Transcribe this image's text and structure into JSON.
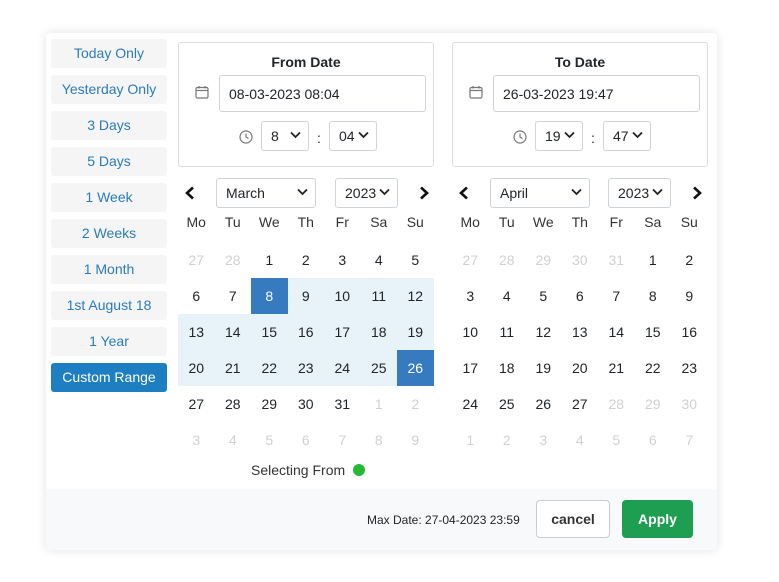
{
  "ranges": [
    {
      "label": "Today Only",
      "active": false
    },
    {
      "label": "Yesterday Only",
      "active": false
    },
    {
      "label": "3 Days",
      "active": false
    },
    {
      "label": "5 Days",
      "active": false
    },
    {
      "label": "1 Week",
      "active": false
    },
    {
      "label": "2 Weeks",
      "active": false
    },
    {
      "label": "1 Month",
      "active": false
    },
    {
      "label": "1st August 18",
      "active": false
    },
    {
      "label": "1 Year",
      "active": false
    },
    {
      "label": "Custom Range",
      "active": true
    }
  ],
  "from": {
    "title": "From Date",
    "value": "08-03-2023 08:04",
    "hour": "8",
    "minute": "04"
  },
  "to": {
    "title": "To Date",
    "value": "26-03-2023 19:47",
    "hour": "19",
    "minute": "47"
  },
  "time_separator": ":",
  "weekdays": [
    "Mo",
    "Tu",
    "We",
    "Th",
    "Fr",
    "Sa",
    "Su"
  ],
  "left_calendar": {
    "month": "March",
    "year": "2023",
    "days": [
      {
        "d": "27",
        "m": true
      },
      {
        "d": "28",
        "m": true
      },
      {
        "d": "1"
      },
      {
        "d": "2"
      },
      {
        "d": "3"
      },
      {
        "d": "4"
      },
      {
        "d": "5"
      },
      {
        "d": "6"
      },
      {
        "d": "7"
      },
      {
        "d": "8",
        "e": true
      },
      {
        "d": "9",
        "r": true
      },
      {
        "d": "10",
        "r": true
      },
      {
        "d": "11",
        "r": true
      },
      {
        "d": "12",
        "r": true
      },
      {
        "d": "13",
        "r": true
      },
      {
        "d": "14",
        "r": true
      },
      {
        "d": "15",
        "r": true
      },
      {
        "d": "16",
        "r": true
      },
      {
        "d": "17",
        "r": true
      },
      {
        "d": "18",
        "r": true
      },
      {
        "d": "19",
        "r": true
      },
      {
        "d": "20",
        "r": true
      },
      {
        "d": "21",
        "r": true
      },
      {
        "d": "22",
        "r": true
      },
      {
        "d": "23",
        "r": true
      },
      {
        "d": "24",
        "r": true
      },
      {
        "d": "25",
        "r": true
      },
      {
        "d": "26",
        "e": true
      },
      {
        "d": "27"
      },
      {
        "d": "28"
      },
      {
        "d": "29"
      },
      {
        "d": "30"
      },
      {
        "d": "31"
      },
      {
        "d": "1",
        "m": true
      },
      {
        "d": "2",
        "m": true
      },
      {
        "d": "3",
        "m": true
      },
      {
        "d": "4",
        "m": true
      },
      {
        "d": "5",
        "m": true
      },
      {
        "d": "6",
        "m": true
      },
      {
        "d": "7",
        "m": true
      },
      {
        "d": "8",
        "m": true
      },
      {
        "d": "9",
        "m": true
      }
    ]
  },
  "right_calendar": {
    "month": "April",
    "year": "2023",
    "days": [
      {
        "d": "27",
        "m": true
      },
      {
        "d": "28",
        "m": true
      },
      {
        "d": "29",
        "m": true
      },
      {
        "d": "30",
        "m": true
      },
      {
        "d": "31",
        "m": true
      },
      {
        "d": "1"
      },
      {
        "d": "2"
      },
      {
        "d": "3"
      },
      {
        "d": "4"
      },
      {
        "d": "5"
      },
      {
        "d": "6"
      },
      {
        "d": "7"
      },
      {
        "d": "8"
      },
      {
        "d": "9"
      },
      {
        "d": "10"
      },
      {
        "d": "11"
      },
      {
        "d": "12"
      },
      {
        "d": "13"
      },
      {
        "d": "14"
      },
      {
        "d": "15"
      },
      {
        "d": "16"
      },
      {
        "d": "17"
      },
      {
        "d": "18"
      },
      {
        "d": "19"
      },
      {
        "d": "20"
      },
      {
        "d": "21"
      },
      {
        "d": "22"
      },
      {
        "d": "23"
      },
      {
        "d": "24"
      },
      {
        "d": "25"
      },
      {
        "d": "26"
      },
      {
        "d": "27"
      },
      {
        "d": "28",
        "m": true
      },
      {
        "d": "29",
        "m": true
      },
      {
        "d": "30",
        "m": true
      },
      {
        "d": "1",
        "m": true
      },
      {
        "d": "2",
        "m": true
      },
      {
        "d": "3",
        "m": true
      },
      {
        "d": "4",
        "m": true
      },
      {
        "d": "5",
        "m": true
      },
      {
        "d": "6",
        "m": true
      },
      {
        "d": "7",
        "m": true
      }
    ]
  },
  "status": {
    "text": "Selecting From",
    "dot_color": "#22bb33"
  },
  "footer": {
    "max_date": "Max Date: 27-04-2023 23:59",
    "cancel_label": "cancel",
    "apply_label": "Apply"
  },
  "colors": {
    "accent": "#1d7ec2",
    "endpoint": "#367ac0",
    "range_bg": "#e8f2f9",
    "apply": "#1e9e50"
  },
  "icons": {
    "date_field": "calendar-icon",
    "time_field": "clock-icon",
    "prev": "chevron-left-icon",
    "next": "chevron-right-icon",
    "select": "chevron-down-icon"
  }
}
